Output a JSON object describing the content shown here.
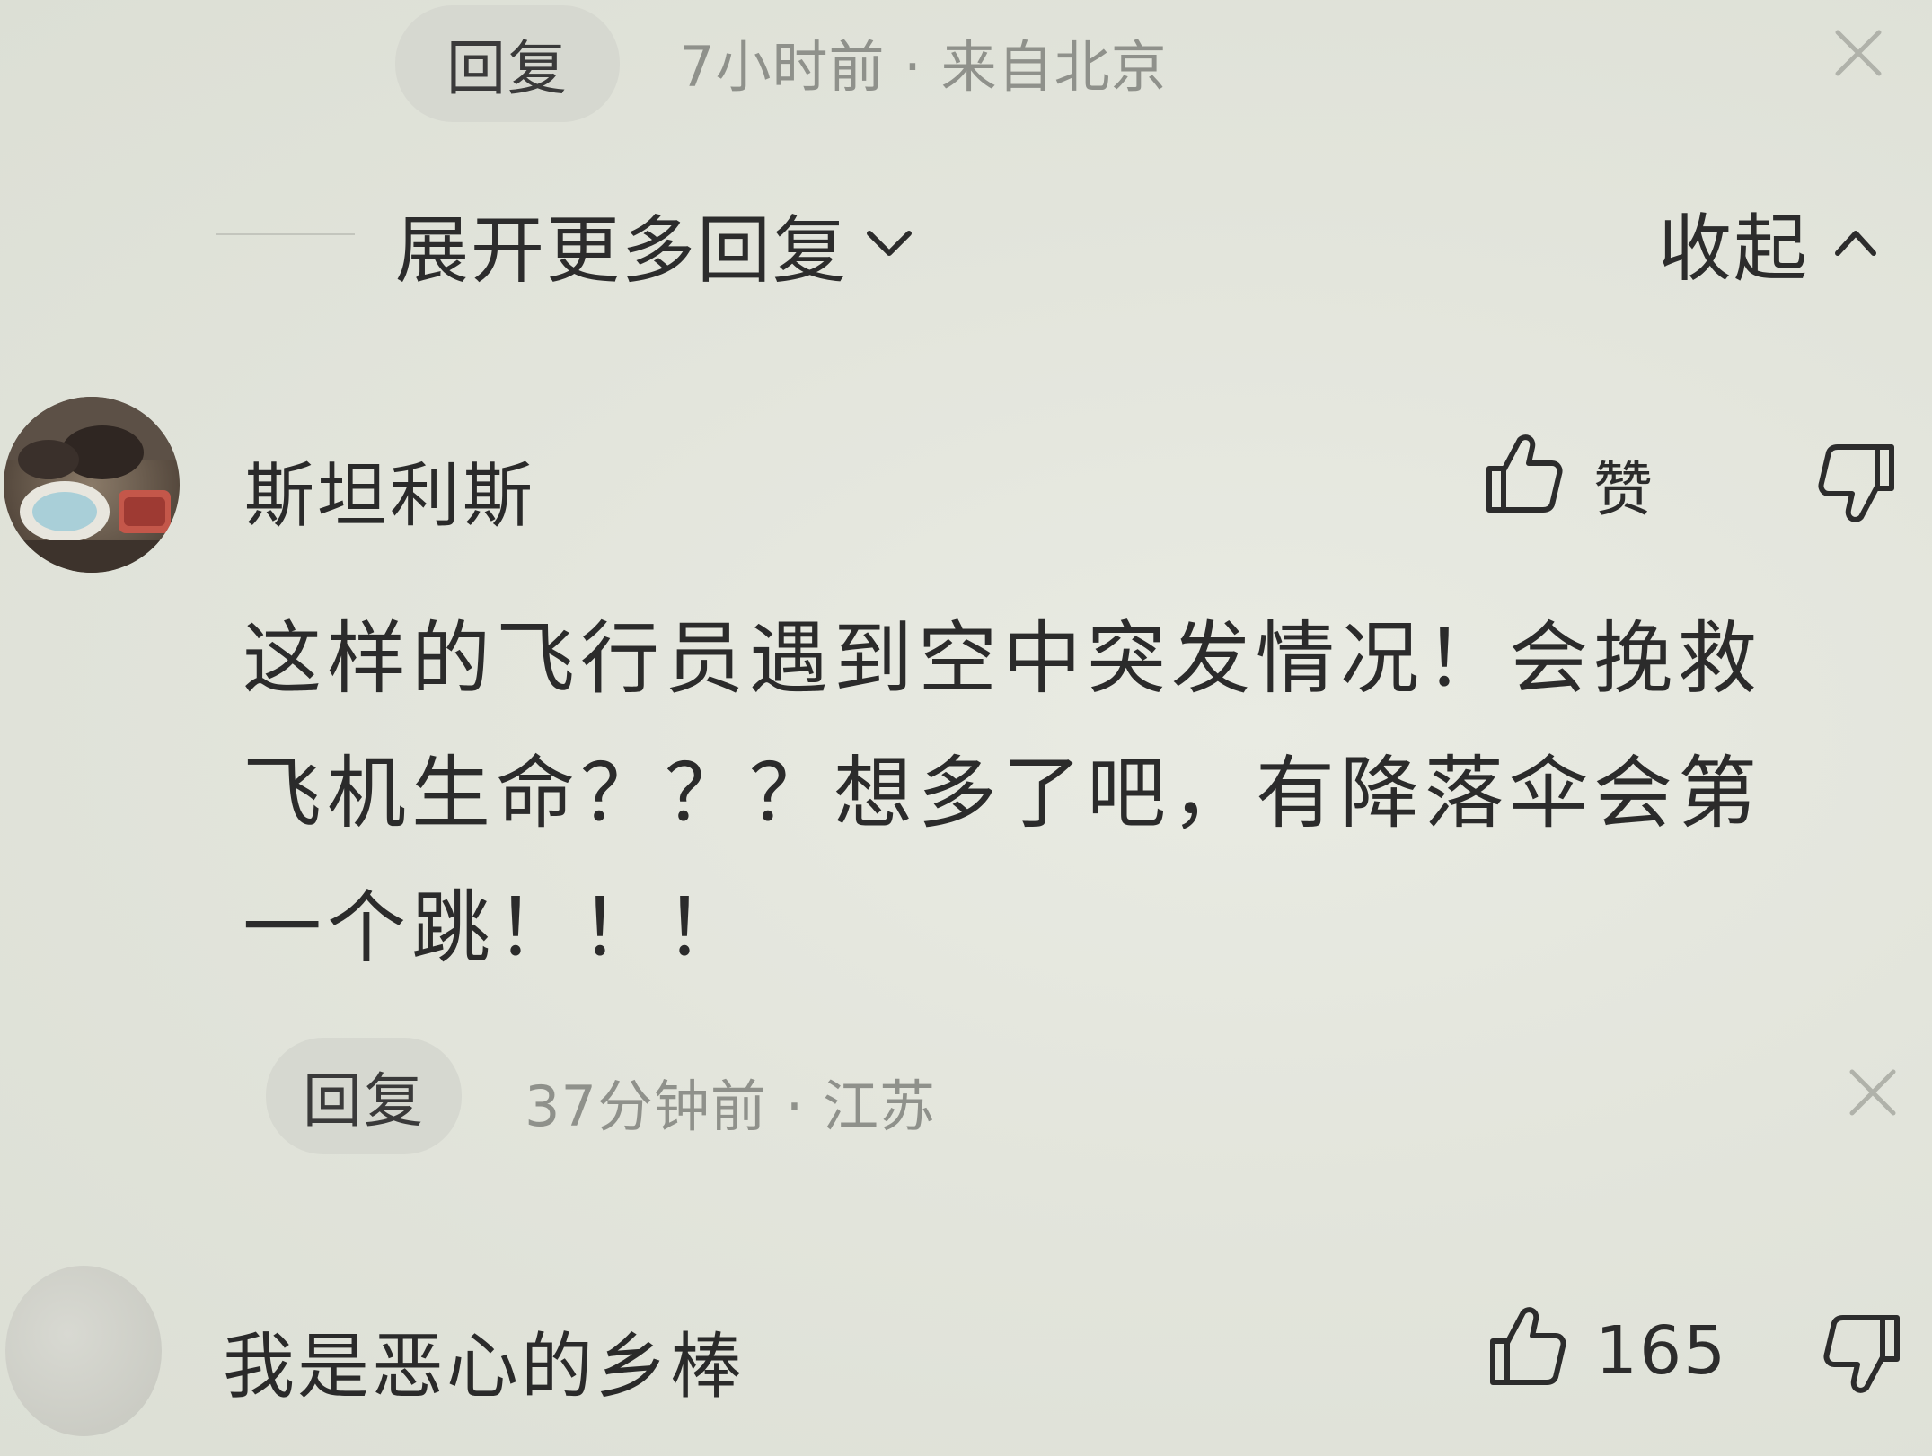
{
  "top_reply": {
    "reply_label": "回复",
    "meta": "7小时前 · 来自北京"
  },
  "thread": {
    "expand_label": "展开更多回复",
    "collapse_label": "收起"
  },
  "comment": {
    "username": "斯坦利斯",
    "like_label": "赞",
    "body_lines": [
      "这样的飞行员遇到空中突发情况！会挽救",
      "飞机生命？？？想多了吧，有降落伞会第",
      "一个跳！！！"
    ],
    "reply_label": "回复",
    "meta": "37分钟前 · 江苏"
  },
  "next_comment": {
    "username": "我是恶心的乡棒",
    "like_count": "165"
  },
  "icons": {
    "like": "thumbs-up-icon",
    "dislike": "thumbs-down-icon",
    "close": "close-icon",
    "expand": "chevron-down-icon",
    "collapse": "chevron-up-icon"
  }
}
